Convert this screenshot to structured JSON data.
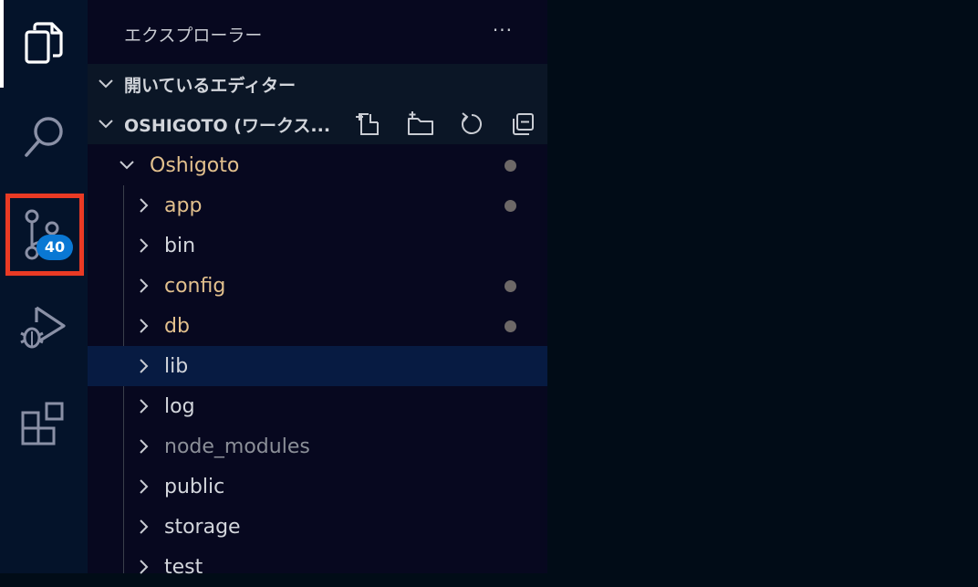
{
  "sidebar": {
    "title": "エクスプローラー",
    "more": "···",
    "open_editors": "開いているエディター",
    "workspace": "OSHIGOTO (ワークス..."
  },
  "activity": {
    "scm_badge": "40",
    "highlight_color": "#ea3a24",
    "badge_color": "#0a78d4"
  },
  "tree": {
    "root": "Oshigoto",
    "folders": [
      {
        "name": "app",
        "modified": true
      },
      {
        "name": "bin",
        "modified": false
      },
      {
        "name": "config",
        "modified": true
      },
      {
        "name": "db",
        "modified": true
      },
      {
        "name": "lib",
        "modified": false,
        "selected": true
      },
      {
        "name": "log",
        "modified": false
      },
      {
        "name": "node_modules",
        "modified": false,
        "ignored": true
      },
      {
        "name": "public",
        "modified": false
      },
      {
        "name": "storage",
        "modified": false
      },
      {
        "name": "test",
        "modified": false
      }
    ]
  },
  "colors": {
    "modified": "#e2c08d",
    "modified_dot": "#6d6867",
    "selected_row": "#071b42"
  }
}
